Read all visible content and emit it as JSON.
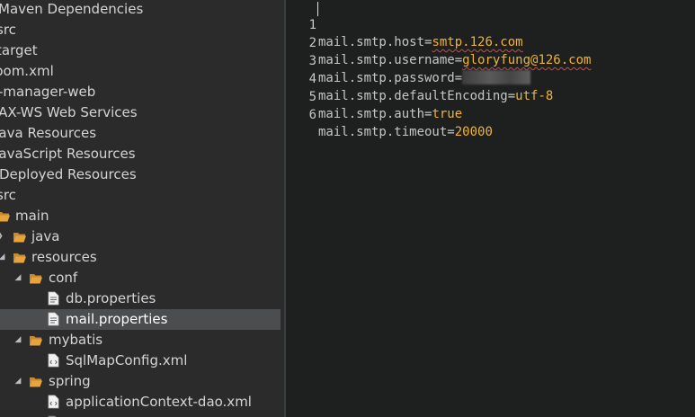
{
  "explorer": {
    "items": [
      {
        "label": "Maven Dependencies",
        "icon": "library-icon"
      },
      {
        "label": "src",
        "icon": "folder-icon"
      },
      {
        "label": "target",
        "icon": "folder-icon"
      },
      {
        "label": "pom.xml",
        "icon": "xml-file-icon"
      },
      {
        "label": "-manager-web",
        "icon": "project-icon"
      },
      {
        "label": "JAX-WS Web Services",
        "icon": "webservice-icon"
      },
      {
        "label": "Java Resources",
        "icon": "java-resources-icon"
      },
      {
        "label": "JavaScript Resources",
        "icon": "js-resources-icon"
      },
      {
        "label": "Deployed Resources",
        "icon": "deployed-icon"
      },
      {
        "label": "src",
        "icon": "folder-icon"
      },
      {
        "label": "main",
        "icon": "folder-open-icon",
        "expanded": true
      },
      {
        "label": "java",
        "icon": "folder-icon",
        "expanded": false
      },
      {
        "label": "resources",
        "icon": "folder-open-icon",
        "expanded": true
      },
      {
        "label": "conf",
        "icon": "folder-open-icon",
        "expanded": true
      },
      {
        "label": "db.properties",
        "icon": "properties-file-icon"
      },
      {
        "label": "mail.properties",
        "icon": "properties-file-icon",
        "selected": true
      },
      {
        "label": "mybatis",
        "icon": "folder-open-icon",
        "expanded": true
      },
      {
        "label": "SqlMapConfig.xml",
        "icon": "xml-file-icon"
      },
      {
        "label": "spring",
        "icon": "folder-open-icon",
        "expanded": true
      },
      {
        "label": "applicationContext-dao.xml",
        "icon": "xml-file-icon"
      }
    ]
  },
  "editor": {
    "lines": [
      {
        "number": "1",
        "key": "mail.smtp.host",
        "eq": "=",
        "value": "smtp.126.com"
      },
      {
        "number": "2",
        "key": "mail.smtp.username",
        "eq": "=",
        "value": "gloryfung@126.com"
      },
      {
        "number": "3",
        "key": "mail.smtp.password",
        "eq": "=",
        "value": ""
      },
      {
        "number": "4",
        "key": "mail.smtp.defaultEncoding",
        "eq": "=",
        "value": "utf-8"
      },
      {
        "number": "5",
        "key": "mail.smtp.auth",
        "eq": "=",
        "value": "true"
      },
      {
        "number": "6",
        "key": "mail.smtp.timeout",
        "eq": "=",
        "value": "20000"
      }
    ]
  },
  "colors": {
    "explorer_bg": "#2b2b2b",
    "editor_bg": "#1e1f1f",
    "selection": "#4b4d4e",
    "value_color": "#f0b430",
    "folder_color": "#e8a33d"
  }
}
